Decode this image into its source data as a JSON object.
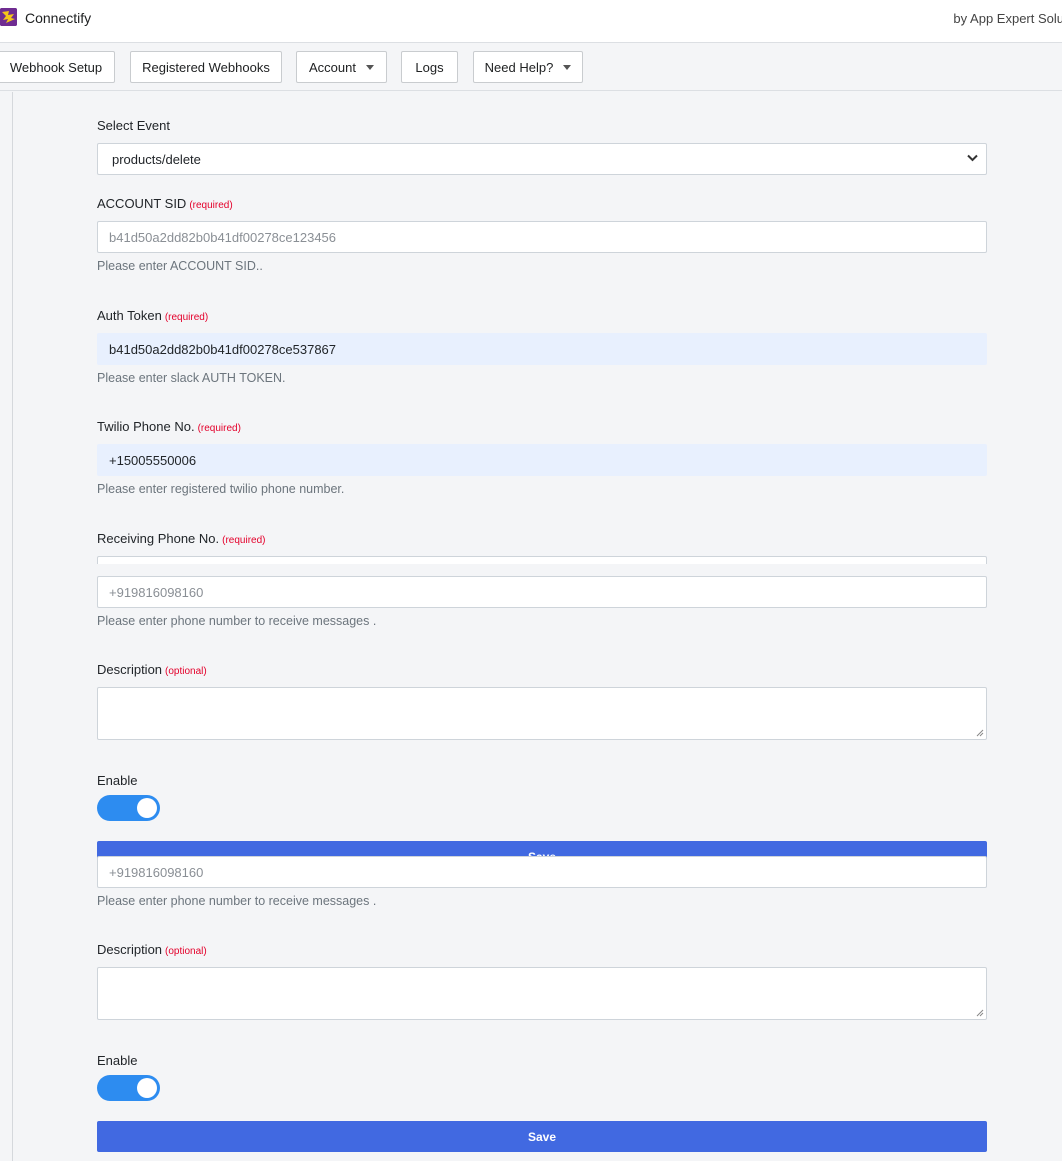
{
  "header": {
    "app_title": "Connectify",
    "byline": "by App Expert Solu"
  },
  "nav": {
    "webhook_setup": "Webhook Setup",
    "registered_webhooks": "Registered Webhooks",
    "account": "Account",
    "logs": "Logs",
    "need_help": "Need Help?"
  },
  "form": {
    "select_event": {
      "label": "Select Event",
      "value": "products/delete"
    },
    "account_sid": {
      "label": "ACCOUNT SID",
      "tag": "(required)",
      "placeholder": "b41d50a2dd82b0b41df00278ce123456",
      "help": "Please enter ACCOUNT SID.."
    },
    "auth_token": {
      "label": "Auth Token",
      "tag": "(required)",
      "value": "b41d50a2dd82b0b41df00278ce537867",
      "help": "Please enter slack AUTH TOKEN."
    },
    "twilio_phone": {
      "label": "Twilio Phone No.",
      "tag": "(required)",
      "value": "+15005550006",
      "help": "Please enter registered twilio phone number."
    },
    "receiving_phone": {
      "label": "Receiving Phone No.",
      "tag": "(required)",
      "placeholder": "+919816098160",
      "help": "Please enter phone number to receive messages ."
    },
    "description": {
      "label": "Description",
      "tag": "(optional)"
    },
    "enable": {
      "label": "Enable",
      "checked": true
    },
    "save_label": "Save"
  },
  "colors": {
    "save_button": "#4169e1",
    "toggle_on": "#2d8cf0",
    "required_tag": "#e4002b",
    "autofill_bg": "#e8f0fe"
  }
}
